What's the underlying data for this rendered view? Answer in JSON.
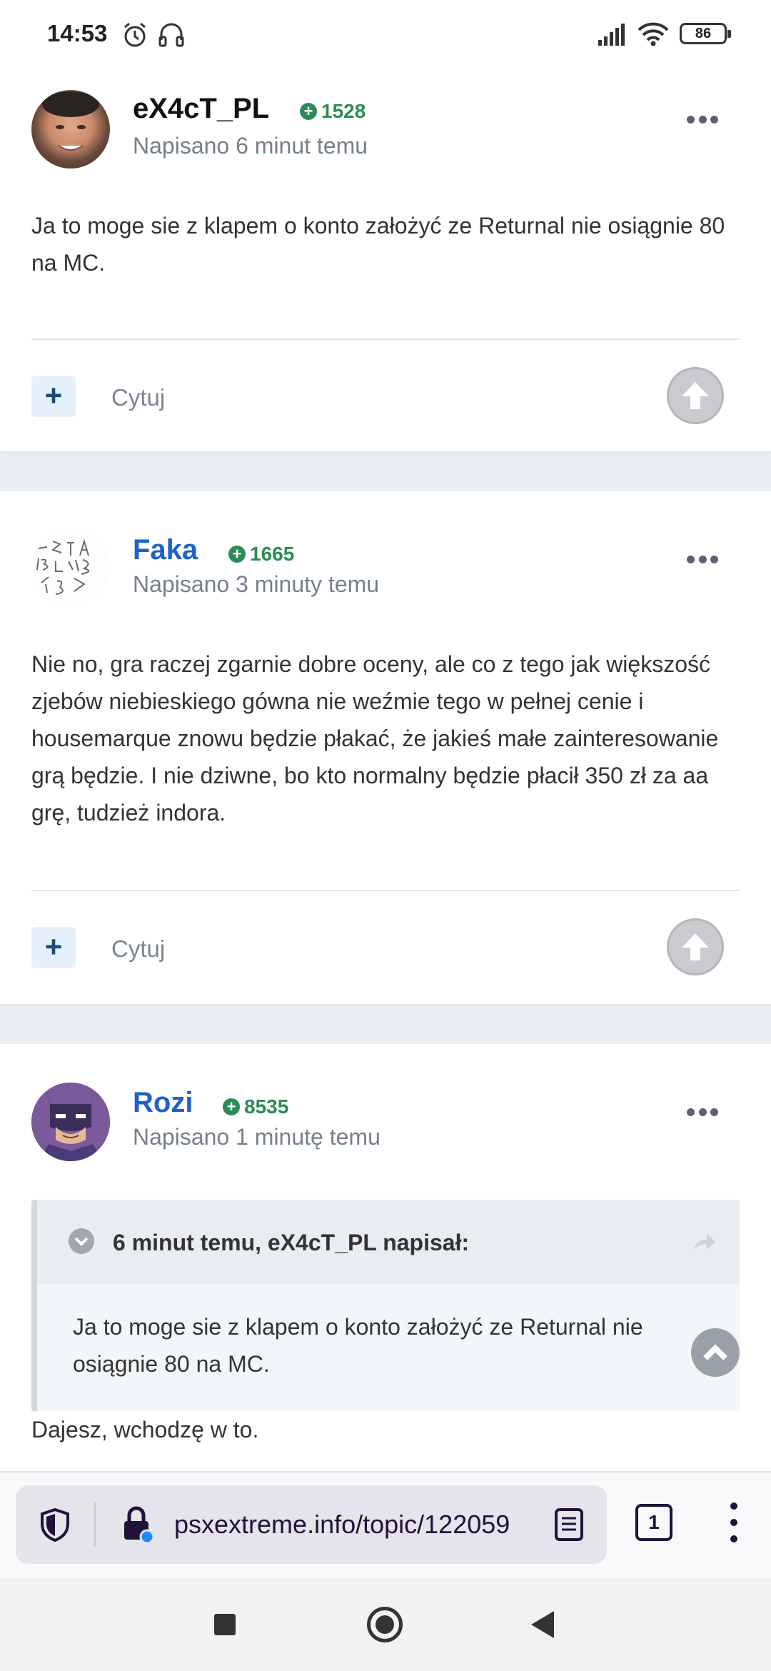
{
  "status_bar": {
    "time": "14:53",
    "battery": "86"
  },
  "posts": [
    {
      "author": "eX4cT_PL",
      "author_color": "#111111",
      "reputation": "1528",
      "posted": "Napisano 6 minut temu",
      "content": "Ja to moge sie z klapem o konto założyć ze Returnal nie osiągnie 80 na MC.",
      "quote_label": "Cytuj"
    },
    {
      "author": "Faka",
      "author_color": "#1f62c8",
      "reputation": "1665",
      "posted": "Napisano 3 minuty temu",
      "content": "Nie no, gra raczej zgarnie dobre oceny, ale co z tego jak większość zjebów niebieskiego gówna nie weźmie tego w pełnej cenie i housemarque znowu będzie płakać, że jakieś małe zainteresowanie grą będzie. I nie dziwne, bo kto normalny będzie płacił 350 zł za aa grę, tudzież indora.",
      "quote_label": "Cytuj"
    },
    {
      "author": "Rozi",
      "author_color": "#1f62c8",
      "reputation": "8535",
      "posted": "Napisano 1 minutę temu",
      "quote": {
        "title": "6 minut temu, eX4cT_PL napisał:",
        "body": "Ja to moge sie z klapem o konto założyć ze Returnal nie osiągnie 80 na MC."
      },
      "content": "Dajesz, wchodzę w to."
    }
  ],
  "browser": {
    "url": "psxextreme.info/topic/122059",
    "tab_count": "1"
  }
}
